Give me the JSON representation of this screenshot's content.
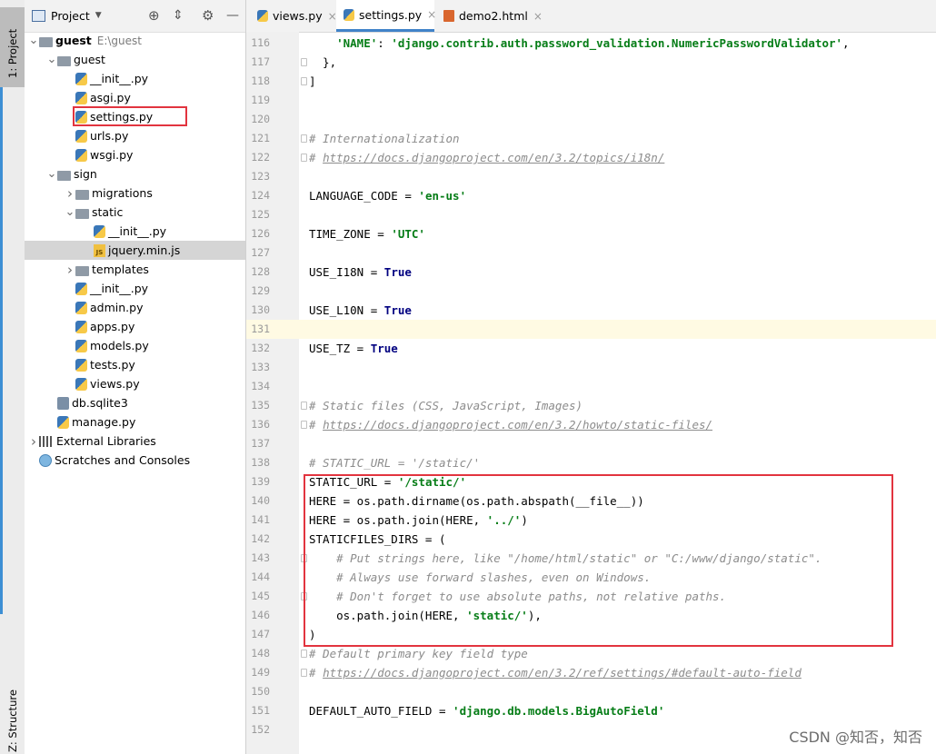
{
  "sidestrip": {
    "project_tab": "1: Project",
    "structure_tab": "Z: Structure"
  },
  "project_panel": {
    "title": "Project",
    "tree": [
      {
        "label": "guest",
        "path": "E:\\guest",
        "type": "folder",
        "depth": 0,
        "expanded": true,
        "bold": true
      },
      {
        "label": "guest",
        "type": "folder",
        "depth": 1,
        "expanded": true
      },
      {
        "label": "__init__.py",
        "type": "py",
        "depth": 2
      },
      {
        "label": "asgi.py",
        "type": "py",
        "depth": 2
      },
      {
        "label": "settings.py",
        "type": "py",
        "depth": 2
      },
      {
        "label": "urls.py",
        "type": "py",
        "depth": 2
      },
      {
        "label": "wsgi.py",
        "type": "py",
        "depth": 2
      },
      {
        "label": "sign",
        "type": "folder",
        "depth": 1,
        "expanded": true
      },
      {
        "label": "migrations",
        "type": "folder",
        "depth": 2,
        "expanded": false
      },
      {
        "label": "static",
        "type": "folder",
        "depth": 2,
        "expanded": true
      },
      {
        "label": "__init__.py",
        "type": "py",
        "depth": 3
      },
      {
        "label": "jquery.min.js",
        "type": "js",
        "depth": 3,
        "selected": true
      },
      {
        "label": "templates",
        "type": "folder",
        "depth": 2,
        "expanded": false
      },
      {
        "label": "__init__.py",
        "type": "py",
        "depth": 2
      },
      {
        "label": "admin.py",
        "type": "py",
        "depth": 2
      },
      {
        "label": "apps.py",
        "type": "py",
        "depth": 2
      },
      {
        "label": "models.py",
        "type": "py",
        "depth": 2
      },
      {
        "label": "tests.py",
        "type": "py",
        "depth": 2
      },
      {
        "label": "views.py",
        "type": "py",
        "depth": 2
      },
      {
        "label": "db.sqlite3",
        "type": "db",
        "depth": 1
      },
      {
        "label": "manage.py",
        "type": "py",
        "depth": 1
      },
      {
        "label": "External Libraries",
        "type": "lib",
        "depth": 0,
        "expanded": false
      },
      {
        "label": "Scratches and Consoles",
        "type": "scratch",
        "depth": 0
      }
    ]
  },
  "tabs": [
    {
      "label": "views.py",
      "active": false
    },
    {
      "label": "settings.py",
      "active": true
    },
    {
      "label": "demo2.html",
      "active": false
    }
  ],
  "editor": {
    "lines": [
      {
        "n": "116",
        "code": "    'NAME': 'django.contrib.auth.password_validation.NumericPasswordValidator',"
      },
      {
        "n": "117",
        "code": "  },"
      },
      {
        "n": "118",
        "code": "]"
      },
      {
        "n": "119",
        "code": ""
      },
      {
        "n": "120",
        "code": ""
      },
      {
        "n": "121",
        "code": "# Internationalization"
      },
      {
        "n": "122",
        "code": "# https://docs.djangoproject.com/en/3.2/topics/i18n/"
      },
      {
        "n": "123",
        "code": ""
      },
      {
        "n": "124",
        "code": "LANGUAGE_CODE = 'en-us'"
      },
      {
        "n": "125",
        "code": ""
      },
      {
        "n": "126",
        "code": "TIME_ZONE = 'UTC'"
      },
      {
        "n": "127",
        "code": ""
      },
      {
        "n": "128",
        "code": "USE_I18N = True"
      },
      {
        "n": "129",
        "code": ""
      },
      {
        "n": "130",
        "code": "USE_L10N = True"
      },
      {
        "n": "131",
        "code": ""
      },
      {
        "n": "132",
        "code": "USE_TZ = True"
      },
      {
        "n": "133",
        "code": ""
      },
      {
        "n": "134",
        "code": ""
      },
      {
        "n": "135",
        "code": "# Static files (CSS, JavaScript, Images)"
      },
      {
        "n": "136",
        "code": "# https://docs.djangoproject.com/en/3.2/howto/static-files/"
      },
      {
        "n": "137",
        "code": ""
      },
      {
        "n": "138",
        "code": "# STATIC_URL = '/static/'"
      },
      {
        "n": "139",
        "code": "STATIC_URL = '/static/'"
      },
      {
        "n": "140",
        "code": "HERE = os.path.dirname(os.path.abspath(__file__))"
      },
      {
        "n": "141",
        "code": "HERE = os.path.join(HERE, '../')"
      },
      {
        "n": "142",
        "code": "STATICFILES_DIRS = ("
      },
      {
        "n": "143",
        "code": "    # Put strings here, like \"/home/html/static\" or \"C:/www/django/static\"."
      },
      {
        "n": "144",
        "code": "    # Always use forward slashes, even on Windows."
      },
      {
        "n": "145",
        "code": "    # Don't forget to use absolute paths, not relative paths."
      },
      {
        "n": "146",
        "code": "    os.path.join(HERE, 'static/'),"
      },
      {
        "n": "147",
        "code": ")"
      },
      {
        "n": "148",
        "code": "# Default primary key field type"
      },
      {
        "n": "149",
        "code": "# https://docs.djangoproject.com/en/3.2/ref/settings/#default-auto-field"
      },
      {
        "n": "150",
        "code": ""
      },
      {
        "n": "151",
        "code": "DEFAULT_AUTO_FIELD = 'django.db.models.BigAutoField'"
      },
      {
        "n": "152",
        "code": ""
      }
    ]
  },
  "watermark": "CSDN @知否，知否",
  "colors": {
    "highlight_red": "#e2343f",
    "current_line": "#fffae3",
    "keyword": "#000080",
    "string": "#067d17",
    "comment": "#8c8c8c"
  }
}
